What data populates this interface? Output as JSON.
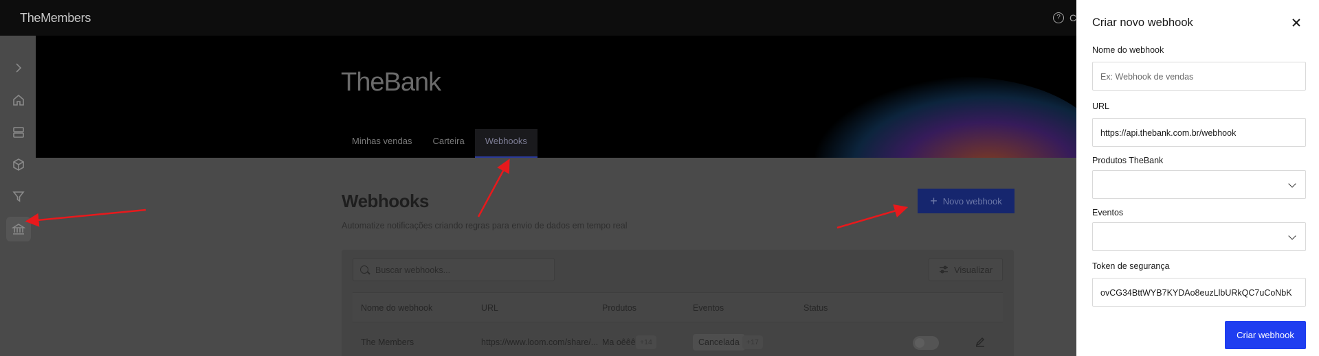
{
  "app": {
    "brand": "TheMembers",
    "help_letter": "C"
  },
  "rail": {
    "items": [
      {
        "icon": "chevron-right-icon"
      },
      {
        "icon": "home-icon"
      },
      {
        "icon": "layers-icon"
      },
      {
        "icon": "cube-icon"
      },
      {
        "icon": "filter-icon"
      },
      {
        "icon": "bank-icon",
        "active": true
      }
    ]
  },
  "hero": {
    "title": "TheBank",
    "tabs": [
      {
        "label": "Minhas vendas"
      },
      {
        "label": "Carteira"
      },
      {
        "label": "Webhooks",
        "active": true
      }
    ]
  },
  "main": {
    "title": "Webhooks",
    "subtitle": "Automatize notificações criando regras para envio de dados em tempo real",
    "new_button": "Novo webhook",
    "search_placeholder": "Buscar webhooks...",
    "visualize_button": "Visualizar",
    "table": {
      "headers": [
        "Nome do webhook",
        "URL",
        "Produtos",
        "Eventos",
        "Status"
      ],
      "rows": [
        {
          "name": "The Members",
          "url": "https://www.loom.com/share/...",
          "product": "Ma oêêê",
          "product_more": "+14",
          "event": "Cancelada",
          "event_more": "+17",
          "status_on": false
        }
      ]
    }
  },
  "drawer": {
    "title": "Criar novo webhook",
    "name_label": "Nome do webhook",
    "name_placeholder": "Ex: Webhook de vendas",
    "url_label": "URL",
    "url_value": "https://api.thebank.com.br/webhook",
    "products_label": "Produtos TheBank",
    "products_value": "",
    "events_label": "Eventos",
    "events_value": "",
    "token_label": "Token de segurança",
    "token_value": "ovCG34BttWYB7KYDAo8euzLlbURkQC7uCoNbK",
    "submit": "Criar webhook"
  },
  "colors": {
    "primary": "#1f3ef0",
    "annotation_arrow": "#e8191c"
  }
}
